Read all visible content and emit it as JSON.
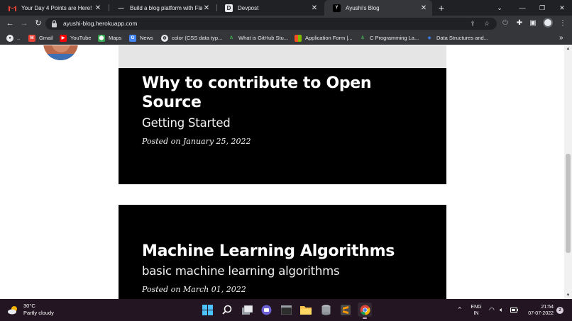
{
  "browser": {
    "tabs": [
      {
        "title": "Your Day 4 Points are Here! - ayus",
        "favicon": "gmail-icon",
        "active": false
      },
      {
        "title": "Build a blog platform with Flask",
        "favicon": "dash-icon",
        "active": false
      },
      {
        "title": "Devpost",
        "favicon": "devpost-icon",
        "active": false
      },
      {
        "title": "Ayushi's Blog",
        "favicon": "blog-icon",
        "active": true
      }
    ],
    "new_tab_label": "+",
    "url": "ayushi-blog.herokuapp.com",
    "bookmarks": [
      {
        "label": "..",
        "icon": "github-icon"
      },
      {
        "label": "Gmail",
        "icon": "gmail-icon"
      },
      {
        "label": "YouTube",
        "icon": "youtube-icon"
      },
      {
        "label": "Maps",
        "icon": "maps-icon"
      },
      {
        "label": "News",
        "icon": "news-icon"
      },
      {
        "label": "color (CSS data typ...",
        "icon": "globe-icon"
      },
      {
        "label": "What is GitHub Stu...",
        "icon": "link-icon"
      },
      {
        "label": "Application Form |...",
        "icon": "microsoft-icon"
      },
      {
        "label": "C Programming La...",
        "icon": "link-icon"
      },
      {
        "label": "Data Structures and...",
        "icon": "edge-icon"
      }
    ],
    "more_bookmarks": "»"
  },
  "page": {
    "posts": [
      {
        "title_line1": "Why to contribute to Open",
        "title_line2": "Source",
        "subtitle": "Getting Started",
        "meta": "Posted on January 25, 2022"
      },
      {
        "title_line1": "Machine Learning Algorithms",
        "title_line2": "",
        "subtitle": "basic machine learning algorithms",
        "meta": "Posted on March 01, 2022"
      }
    ]
  },
  "taskbar": {
    "weather_temp": "30°C",
    "weather_desc": "Partly cloudy",
    "lang_line1": "ENG",
    "lang_line2": "IN",
    "time": "21:54",
    "date": "07-07-2022",
    "notifications": "2"
  },
  "colors": {
    "tab_bg": "#202124",
    "toolbar_bg": "#35363a",
    "card_bg": "#000000",
    "taskbar_bg": "#231622"
  }
}
